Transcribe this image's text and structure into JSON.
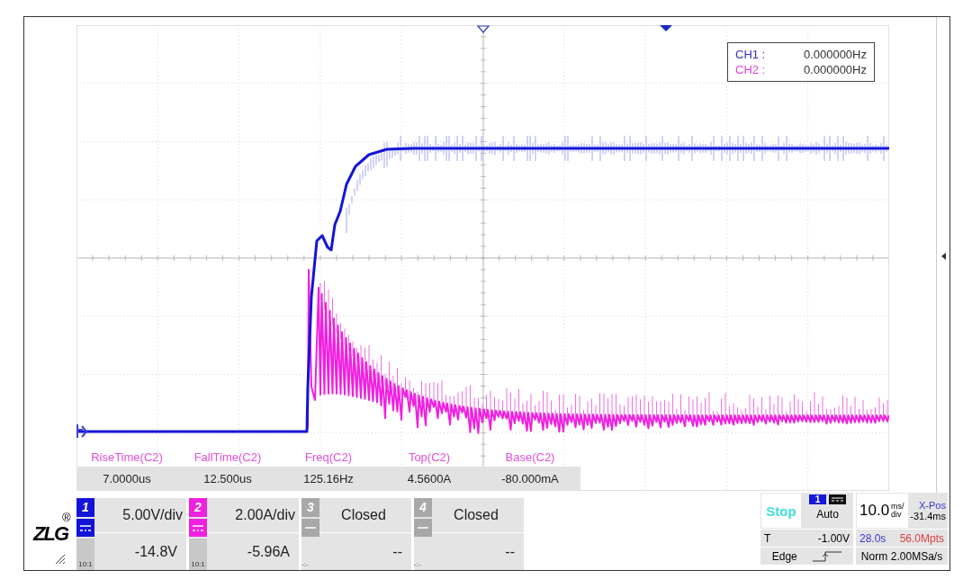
{
  "freq_counter": [
    {
      "label": "CH1 :",
      "value": "0.000000Hz",
      "color": "#3030c8"
    },
    {
      "label": "CH2 :",
      "value": "0.000000Hz",
      "color": "#e040d8"
    }
  ],
  "measurements": [
    {
      "label": "RiseTime(C2)",
      "value": "7.0000us"
    },
    {
      "label": "FallTime(C2)",
      "value": "12.500us"
    },
    {
      "label": "Freq(C2)",
      "value": "125.16Hz"
    },
    {
      "label": "Top(C2)",
      "value": "4.5600A"
    },
    {
      "label": "Base(C2)",
      "value": "-80.000mA"
    }
  ],
  "logo": {
    "text": "ZLG",
    "mark": "®"
  },
  "channels": [
    {
      "number": "1",
      "open": true,
      "color": "#1414d8",
      "scale": "5.00V/div",
      "offset": "-14.8V",
      "probe": "10:1"
    },
    {
      "number": "2",
      "open": true,
      "color": "#f020e0",
      "scale": "2.00A/div",
      "offset": "-5.96A",
      "probe": "10:1"
    },
    {
      "number": "3",
      "open": false,
      "color": "#a8a8a8",
      "scale": "Closed",
      "offset": "--",
      "probe": "-:-"
    },
    {
      "number": "4",
      "open": false,
      "color": "#a8a8a8",
      "scale": "Closed",
      "offset": "--",
      "probe": "-:-"
    }
  ],
  "trigger": {
    "state": "Stop",
    "source": "1",
    "mode": "Auto",
    "label": "T",
    "threshold": "-1.00V",
    "type": "Edge"
  },
  "timebase": {
    "scale": "10.0",
    "unit_top": "ms/",
    "unit_bottom": "div",
    "xpos_label": "X-Pos",
    "xpos": "-31.4ms",
    "duration": "28.0s",
    "depth": "56.0Mpts",
    "acq_mode": "Norm",
    "sample_rate": "2.00MSa/s"
  }
}
